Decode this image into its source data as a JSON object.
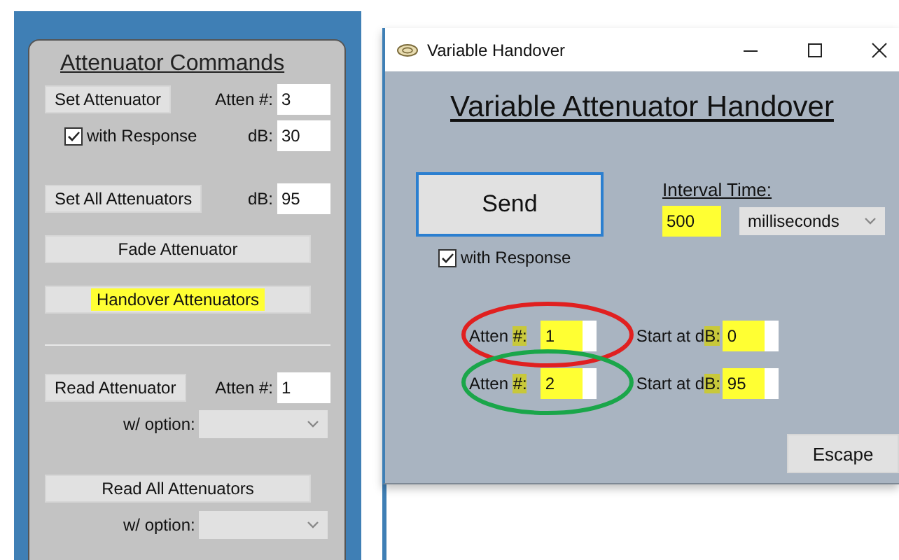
{
  "command_panel": {
    "title": "Attenuator Commands",
    "groups": [
      [
        {
          "kind": "button_field",
          "button": "Set Attenuator",
          "label": "Atten #:",
          "value": "3"
        },
        {
          "kind": "check_field",
          "check_label": "with Response",
          "checked": true,
          "label": "dB:",
          "value": "30"
        },
        {
          "kind": "button_field",
          "button": "Set All Attenuators",
          "label": "dB:",
          "value": "95"
        },
        {
          "kind": "wide_button",
          "button": "Fade Attenuator",
          "highlighted": false
        },
        {
          "kind": "wide_button",
          "button": "Handover Attenuators",
          "highlighted": true
        }
      ],
      [
        {
          "kind": "button_field",
          "button": "Read Attenuator",
          "label": "Atten #:",
          "value": "1"
        },
        {
          "kind": "select_row",
          "label": "w/ option:"
        },
        {
          "kind": "wide_button",
          "button": "Read All Attenuators",
          "highlighted": false
        },
        {
          "kind": "select_row",
          "label": "w/ option:"
        }
      ]
    ]
  },
  "dialog": {
    "title": "Variable Handover",
    "heading": "Variable Attenuator Handover",
    "send_button": "Send",
    "with_response": {
      "label": "with Response",
      "checked": true
    },
    "interval": {
      "label": "Interval Time:",
      "value": "500",
      "highlighted": true,
      "unit": "milliseconds"
    },
    "handover_rows": [
      {
        "atten_label": [
          {
            "text": "Atten ",
            "highlighted": false
          },
          {
            "text": "#:",
            "highlighted": true
          }
        ],
        "atten_value": "1",
        "start_label": [
          {
            "text": "Start at d",
            "highlighted": false
          },
          {
            "text": "B:",
            "highlighted": true
          }
        ],
        "start_value": "0",
        "color": "#e02020"
      },
      {
        "atten_label": [
          {
            "text": "Atten ",
            "highlighted": false
          },
          {
            "text": "#:",
            "highlighted": true
          }
        ],
        "atten_value": "2",
        "start_label": [
          {
            "text": "Start at d",
            "highlighted": false
          },
          {
            "text": "B:",
            "highlighted": true
          }
        ],
        "start_value": "95",
        "color": "#1aa64a"
      }
    ],
    "escape_button": "Escape"
  }
}
